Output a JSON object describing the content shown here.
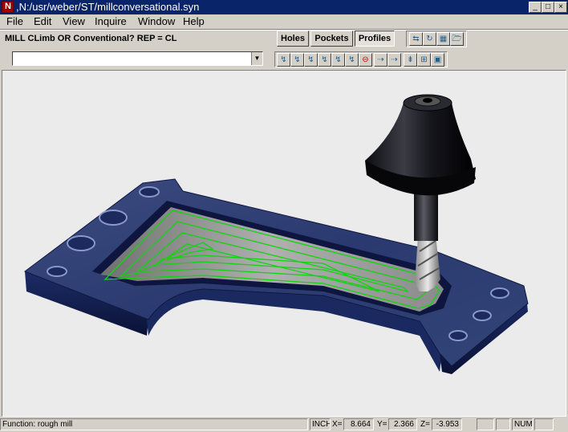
{
  "window": {
    "title": ",N:/usr/weber/ST/millconversational.syn",
    "minimize": "_",
    "maximize": "□",
    "close": "×"
  },
  "menu": [
    "File",
    "Edit",
    "View",
    "Inquire",
    "Window",
    "Help"
  ],
  "prompt": "MILL CLimb OR Conventional?  REP = CL",
  "tabs": {
    "holes": "Holes",
    "pockets": "Pockets",
    "profiles": "Profiles",
    "active": "Profiles"
  },
  "combo": {
    "value": "",
    "arrow": "▼"
  },
  "icons": {
    "top": [
      "⇆",
      "↻",
      "▦",
      "🗁"
    ],
    "second": [
      "↯",
      "↯",
      "↯",
      "↯",
      "↯",
      "↯",
      "⊖",
      "⇢",
      "⇢",
      "⇟",
      "⊞",
      "▣"
    ]
  },
  "status": {
    "function_label": "Function: rough mill",
    "units": "INCH",
    "x_label": "X=",
    "x_value": "8.664",
    "y_label": "Y=",
    "y_value": "2.366",
    "z_label": "Z=",
    "z_value": "-3.953",
    "num": "NUM"
  },
  "colors": {
    "part": "#1a2c6a",
    "toolpath": "#11d411",
    "background": "#ebebeb",
    "titlebar": "#0a246a"
  }
}
